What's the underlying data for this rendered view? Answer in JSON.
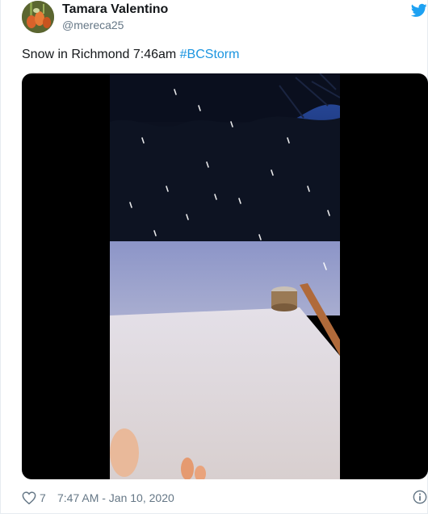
{
  "author": {
    "name": "Tamara Valentino",
    "handle": "@mereca25",
    "avatar_icon": "avatar-photo"
  },
  "tweet": {
    "text": "Snow in Richmond 7:46am ",
    "hashtag": "#BCStorm"
  },
  "media": {
    "type": "video",
    "description_icon": "video-thumbnail"
  },
  "footer": {
    "like_count": "7",
    "timestamp": "7:47 AM - Jan 10, 2020"
  },
  "icons": {
    "brand": "twitter-bird-icon",
    "like": "heart-icon",
    "info": "info-icon"
  },
  "colors": {
    "brand": "#1da1f2",
    "hashtag": "#1b95e0",
    "secondary_text": "#657786",
    "primary_text": "#14171a"
  }
}
